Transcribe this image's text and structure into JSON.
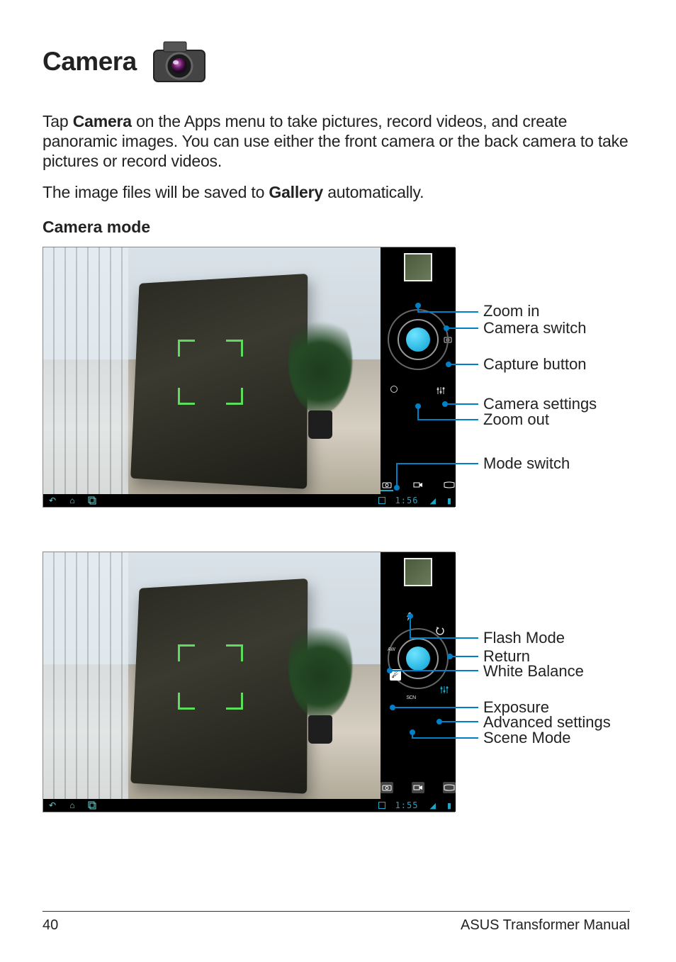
{
  "heading": "Camera",
  "intro_pre": "Tap ",
  "intro_bold1": "Camera",
  "intro_mid": " on the Apps menu to take pictures, record videos, and create panoramic images. You can use either the front camera or the back camera to take pictures or record videos.",
  "intro2_pre": "The image files will be saved to ",
  "intro2_bold": "Gallery",
  "intro2_post": " automatically.",
  "subheading": "Camera mode",
  "fig1": {
    "clock": "1:56",
    "callouts": {
      "zoom_in": "Zoom in",
      "camera_switch": "Camera switch",
      "capture_button": "Capture button",
      "camera_settings": "Camera settings",
      "zoom_out": "Zoom out",
      "mode_switch": "Mode switch"
    }
  },
  "fig2": {
    "clock": "1:55",
    "callouts": {
      "flash_mode": "Flash Mode",
      "return": "Return",
      "white_balance": "White Balance",
      "exposure": "Exposure",
      "advanced_settings": "Advanced settings",
      "scene_mode": "Scene Mode"
    }
  },
  "footer": {
    "page_number": "40",
    "manual_title": "ASUS Transformer Manual"
  }
}
